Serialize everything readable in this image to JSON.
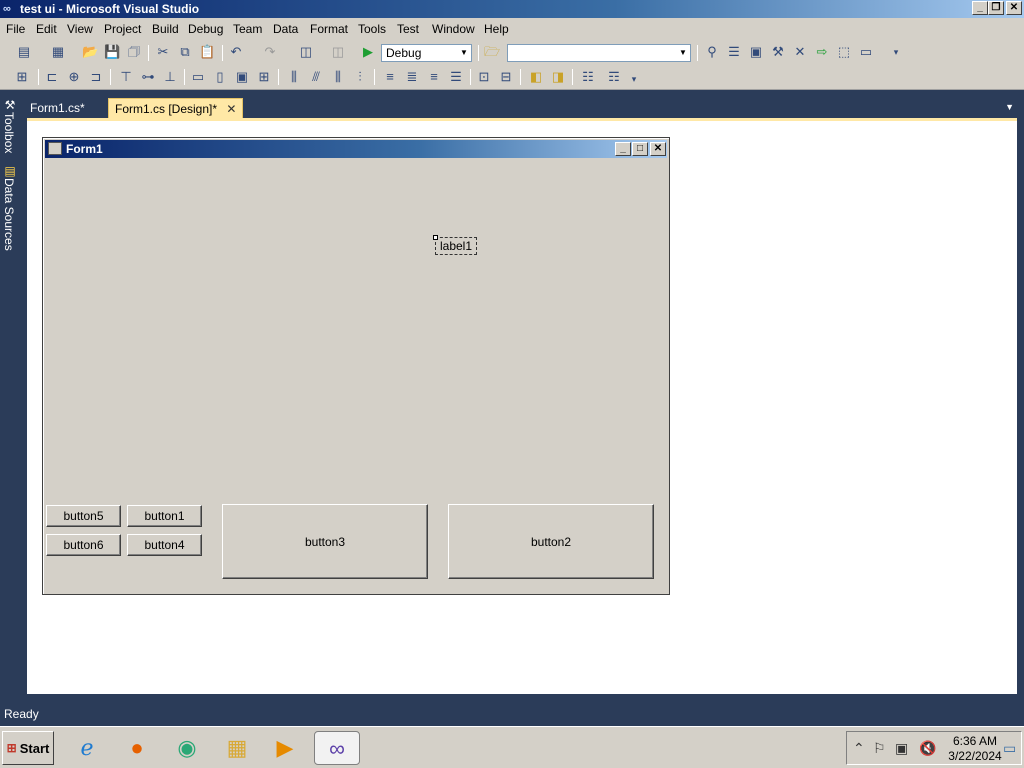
{
  "window": {
    "title": "test ui - Microsoft Visual Studio"
  },
  "menu": [
    "File",
    "Edit",
    "View",
    "Project",
    "Build",
    "Debug",
    "Team",
    "Data",
    "Format",
    "Tools",
    "Test",
    "Window",
    "Help"
  ],
  "toolbar": {
    "configuration": "Debug",
    "platform": ""
  },
  "side_tabs": {
    "toolbox": "Toolbox",
    "data_sources": "Data Sources"
  },
  "doc_tabs": [
    "Form1.cs*",
    "Form1.cs [Design]*"
  ],
  "form": {
    "title": "Form1",
    "label1": "label1",
    "buttons": {
      "button5": "button5",
      "button1": "button1",
      "button6": "button6",
      "button4": "button4",
      "button3": "button3",
      "button2": "button2"
    }
  },
  "status": "Ready",
  "taskbar": {
    "start": "Start",
    "time": "6:36 AM",
    "date": "3/22/2024"
  }
}
